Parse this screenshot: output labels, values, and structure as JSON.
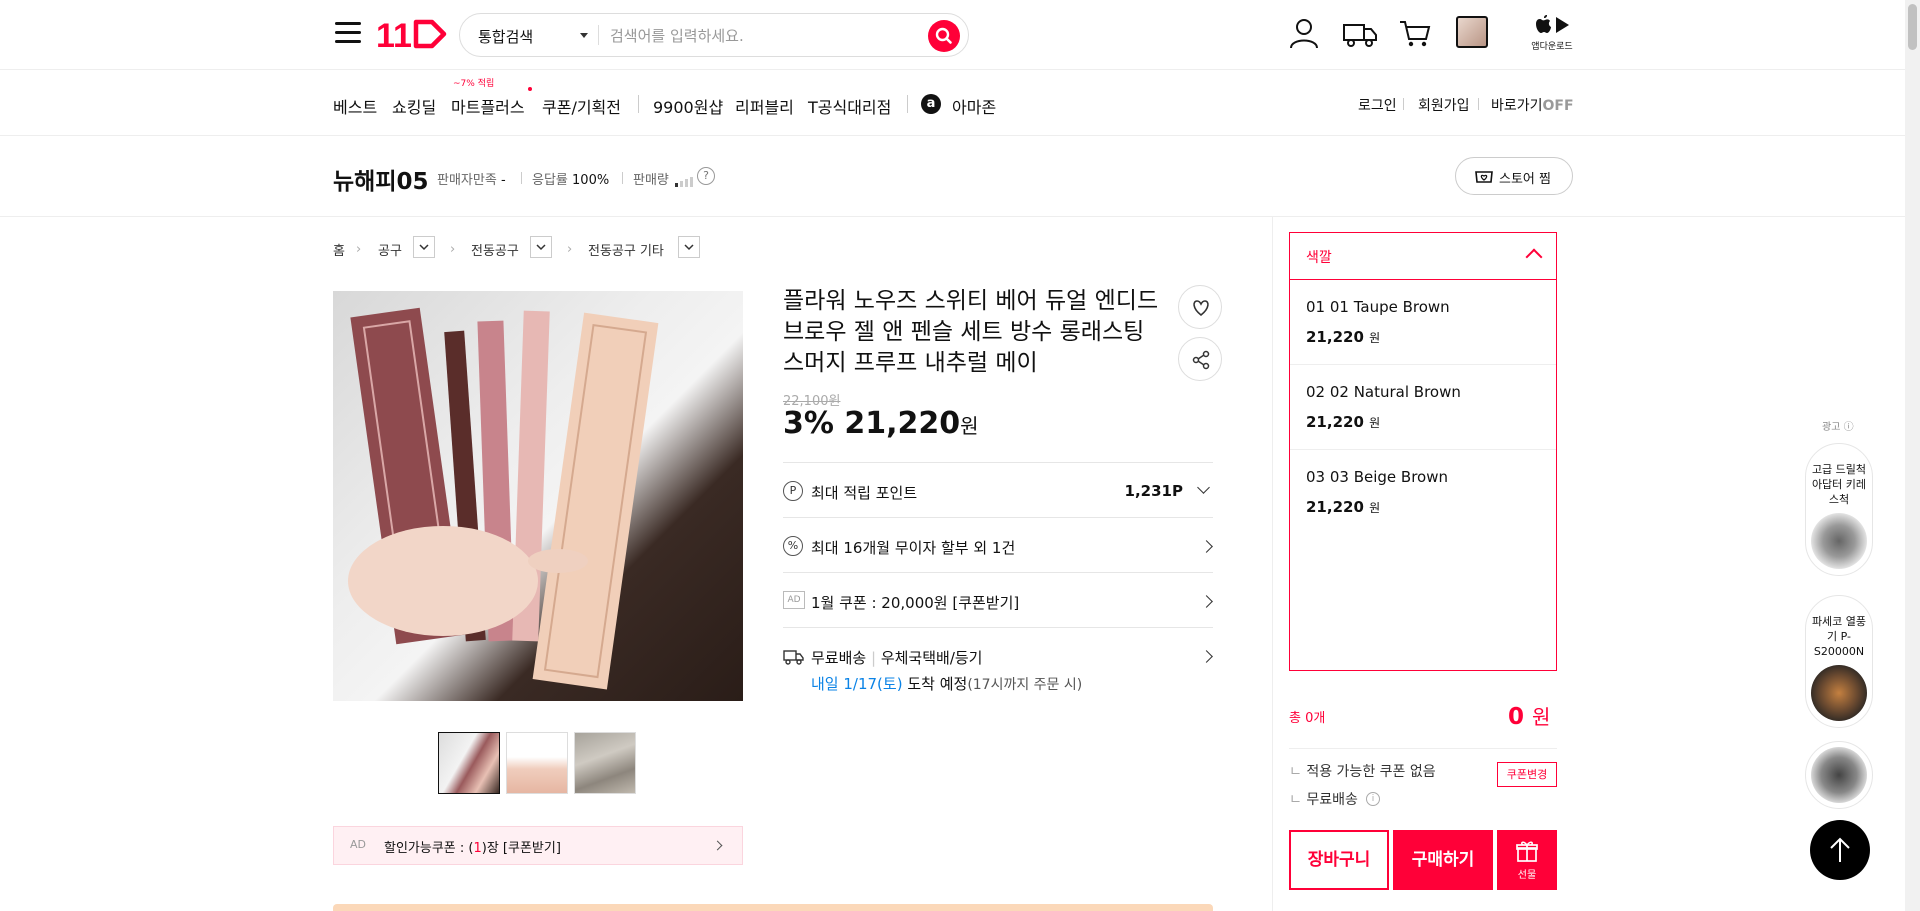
{
  "header": {
    "logo_text": "11",
    "search_category": "통합검색",
    "search_placeholder": "검색어를 입력하세요.",
    "app_download": "앱다운로드"
  },
  "nav": {
    "items": [
      "베스트",
      "쇼킹딜",
      "마트플러스",
      "쿠폰/기획전",
      "9900원샵",
      "리퍼블리",
      "T공식대리점",
      "아마존"
    ],
    "mart_badge": "~7% 적립",
    "right": [
      "로그인",
      "회원가입"
    ],
    "shortcut_label": "바로가기",
    "shortcut_state": "OFF"
  },
  "seller": {
    "name": "뉴해피05",
    "satisfaction_label": "판매자만족",
    "satisfaction_value": "-",
    "response_label": "응답률",
    "response_value": "100%",
    "sales_label": "판매량",
    "store_btn": "스토어 찜"
  },
  "breadcrumb": [
    "홈",
    "공구",
    "전동공구",
    "전동공구 기타"
  ],
  "product": {
    "title": "플라워 노우즈 스위티 베어 듀얼 엔디드 브로우 젤 앤 펜슬 세트 방수 롱래스팅 스머지 프루프 내추럴 메이",
    "original_price": "22,100원",
    "discount": "3%",
    "sale_price": "21,220",
    "won": "원"
  },
  "info_rows": {
    "points_label": "최대 적립 포인트",
    "points_value": "1,231P",
    "installment": "최대 16개월 무이자 할부 외 1건",
    "ad_tag": "AD",
    "coupon": "1월 쿠폰 : 20,000원 [쿠폰받기]",
    "shipping_free": "무료배송",
    "shipping_method": "우체국택배/등기",
    "arrival_date": "내일 1/17(토)",
    "arrival_text": "도착 예정",
    "arrival_note": "(17시까지 주문 시)"
  },
  "coupon_bar": {
    "ad": "AD",
    "prefix": "할인가능쿠폰 : (",
    "count": "1",
    "suffix": ")장 [쿠폰받기]"
  },
  "options": {
    "header": "색깔",
    "items": [
      {
        "name": "01 01 Taupe Brown",
        "price": "21,220",
        "won": "원"
      },
      {
        "name": "02 02 Natural Brown",
        "price": "21,220",
        "won": "원"
      },
      {
        "name": "03 03 Beige Brown",
        "price": "21,220",
        "won": "원"
      }
    ]
  },
  "order": {
    "total_label": "총 0개",
    "total_value": "0",
    "total_won": "원",
    "no_coupon": "적용 가능한 쿠폰 없음",
    "coupon_change": "쿠폰변경",
    "free_ship": "무료배송",
    "cart_btn": "장바구니",
    "buy_btn": "구매하기",
    "gift_btn": "선물"
  },
  "ads": {
    "label": "광고",
    "items": [
      "고급 드릴척 아답터 키레스척",
      "파세코 열풍기 P-S20000N"
    ]
  },
  "colors": {
    "brand": "#ff0038",
    "blue_link": "#0b83e6"
  }
}
